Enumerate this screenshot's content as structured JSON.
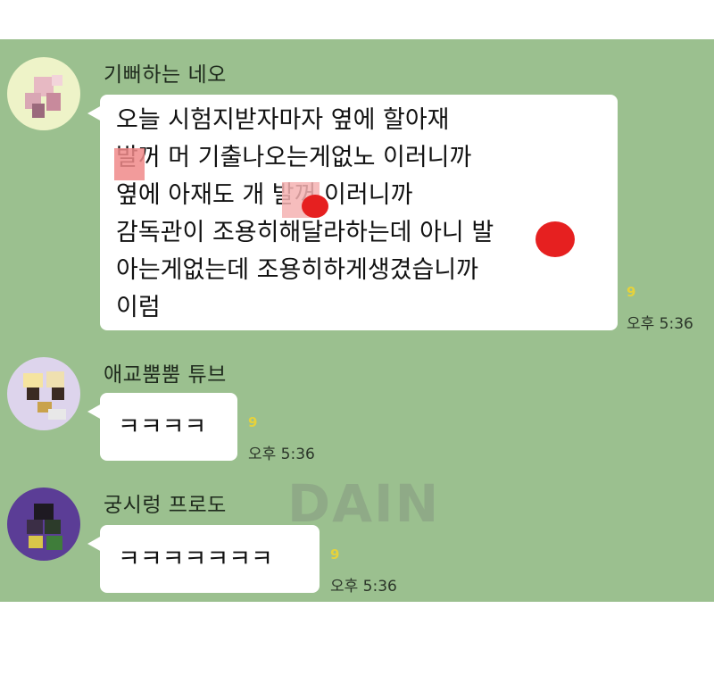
{
  "chat": {
    "background_color": "#9bc08f",
    "messages": [
      {
        "sender": "기뻐하는 네오",
        "lines": [
          "오늘 시험지받자마자 옆에 할아재",
          "  발꺼 머 기출나오는게없노 이러니까",
          "옆에 아재도 개   발꺼 이러니까",
          "감독관이 조용히해달라하는데 아니  발",
          "아는게없는데 조용히하게생겼습니까",
          "이럼"
        ],
        "read_count": "9",
        "time": "오후 5:36"
      },
      {
        "sender": "애교뿜뿜 튜브",
        "lines": [
          "ㅋㅋㅋㅋ"
        ],
        "read_count": "9",
        "time": "오후 5:36"
      },
      {
        "sender": "궁시렁 프로도",
        "lines": [
          "ㅋㅋㅋㅋㅋㅋㅋ"
        ],
        "read_count": "9",
        "time": "오후 5:36"
      }
    ]
  },
  "watermark": "DAIN"
}
